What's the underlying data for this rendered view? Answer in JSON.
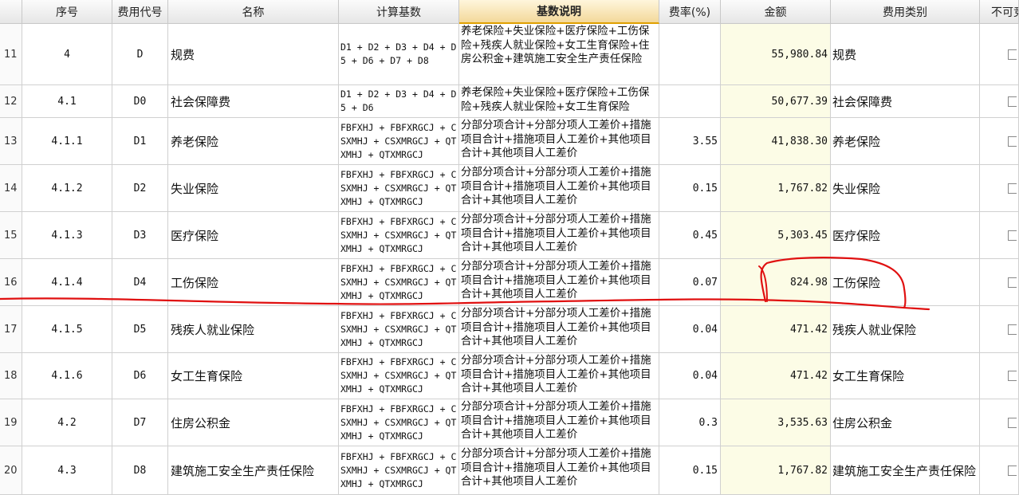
{
  "headers": {
    "seq": "序号",
    "code": "费用代号",
    "name": "名称",
    "formula": "计算基数",
    "desc": "基数说明",
    "rate": "费率(%)",
    "amount": "金额",
    "category": "费用类别",
    "non_compete": "不可竞"
  },
  "rows": [
    {
      "idx": "11",
      "seq": "4",
      "code": "D",
      "name": "规费",
      "formula": "D1 + D2 + D3 + D4 + D5 + D6 + D7 + D8",
      "desc": "养老保险+失业保险+医疗保险+工伤保险+残疾人就业保险+女工生育保险+住房公积金+建筑施工安全生产责任保险",
      "rate": "",
      "amount": "55,980.84",
      "category": "规费"
    },
    {
      "idx": "12",
      "seq": "4.1",
      "code": "D0",
      "name": "社会保障费",
      "formula": "D1 + D2 + D3 + D4 + D5 + D6",
      "desc": "养老保险+失业保险+医疗保险+工伤保险+残疾人就业保险+女工生育保险",
      "rate": "",
      "amount": "50,677.39",
      "category": "社会保障费"
    },
    {
      "idx": "13",
      "seq": "4.1.1",
      "code": "D1",
      "name": "养老保险",
      "formula": "FBFXHJ + FBFXRGCJ + CSXMHJ + CSXMRGCJ + QTXMHJ + QTXMRGCJ",
      "desc": "分部分项合计+分部分项人工差价+措施项目合计+措施项目人工差价+其他项目合计+其他项目人工差价",
      "rate": "3.55",
      "amount": "41,838.30",
      "category": "养老保险"
    },
    {
      "idx": "14",
      "seq": "4.1.2",
      "code": "D2",
      "name": "失业保险",
      "formula": "FBFXHJ + FBFXRGCJ + CSXMHJ + CSXMRGCJ + QTXMHJ + QTXMRGCJ",
      "desc": "分部分项合计+分部分项人工差价+措施项目合计+措施项目人工差价+其他项目合计+其他项目人工差价",
      "rate": "0.15",
      "amount": "1,767.82",
      "category": "失业保险"
    },
    {
      "idx": "15",
      "seq": "4.1.3",
      "code": "D3",
      "name": "医疗保险",
      "formula": "FBFXHJ + FBFXRGCJ + CSXMHJ + CSXMRGCJ + QTXMHJ + QTXMRGCJ",
      "desc": "分部分项合计+分部分项人工差价+措施项目合计+措施项目人工差价+其他项目合计+其他项目人工差价",
      "rate": "0.45",
      "amount": "5,303.45",
      "category": "医疗保险"
    },
    {
      "idx": "16",
      "seq": "4.1.4",
      "code": "D4",
      "name": "工伤保险",
      "formula": "FBFXHJ + FBFXRGCJ + CSXMHJ + CSXMRGCJ + QTXMHJ + QTXMRGCJ",
      "desc": "分部分项合计+分部分项人工差价+措施项目合计+措施项目人工差价+其他项目合计+其他项目人工差价",
      "rate": "0.07",
      "amount": "824.98",
      "category": "工伤保险"
    },
    {
      "idx": "17",
      "seq": "4.1.5",
      "code": "D5",
      "name": "残疾人就业保险",
      "formula": "FBFXHJ + FBFXRGCJ + CSXMHJ + CSXMRGCJ + QTXMHJ + QTXMRGCJ",
      "desc": "分部分项合计+分部分项人工差价+措施项目合计+措施项目人工差价+其他项目合计+其他项目人工差价",
      "rate": "0.04",
      "amount": "471.42",
      "category": "残疾人就业保险"
    },
    {
      "idx": "18",
      "seq": "4.1.6",
      "code": "D6",
      "name": "女工生育保险",
      "formula": "FBFXHJ + FBFXRGCJ + CSXMHJ + CSXMRGCJ + QTXMHJ + QTXMRGCJ",
      "desc": "分部分项合计+分部分项人工差价+措施项目合计+措施项目人工差价+其他项目合计+其他项目人工差价",
      "rate": "0.04",
      "amount": "471.42",
      "category": "女工生育保险"
    },
    {
      "idx": "19",
      "seq": "4.2",
      "code": "D7",
      "name": "住房公积金",
      "formula": "FBFXHJ + FBFXRGCJ + CSXMHJ + CSXMRGCJ + QTXMHJ + QTXMRGCJ",
      "desc": "分部分项合计+分部分项人工差价+措施项目合计+措施项目人工差价+其他项目合计+其他项目人工差价",
      "rate": "0.3",
      "amount": "3,535.63",
      "category": "住房公积金"
    },
    {
      "idx": "20",
      "seq": "4.3",
      "code": "D8",
      "name": "建筑施工安全生产责任保险",
      "formula": "FBFXHJ + FBFXRGCJ + CSXMHJ + CSXMRGCJ + QTXMHJ + QTXMRGCJ",
      "desc": "分部分项合计+分部分项人工差价+措施项目合计+措施项目人工差价+其他项目合计+其他项目人工差价",
      "rate": "0.15",
      "amount": "1,767.82",
      "category": "建筑施工安全生产责任保险"
    }
  ],
  "colors": {
    "amount_bg": "#fcfce6",
    "active_header": "#f3d89a",
    "annotation_ink": "#e01010"
  }
}
